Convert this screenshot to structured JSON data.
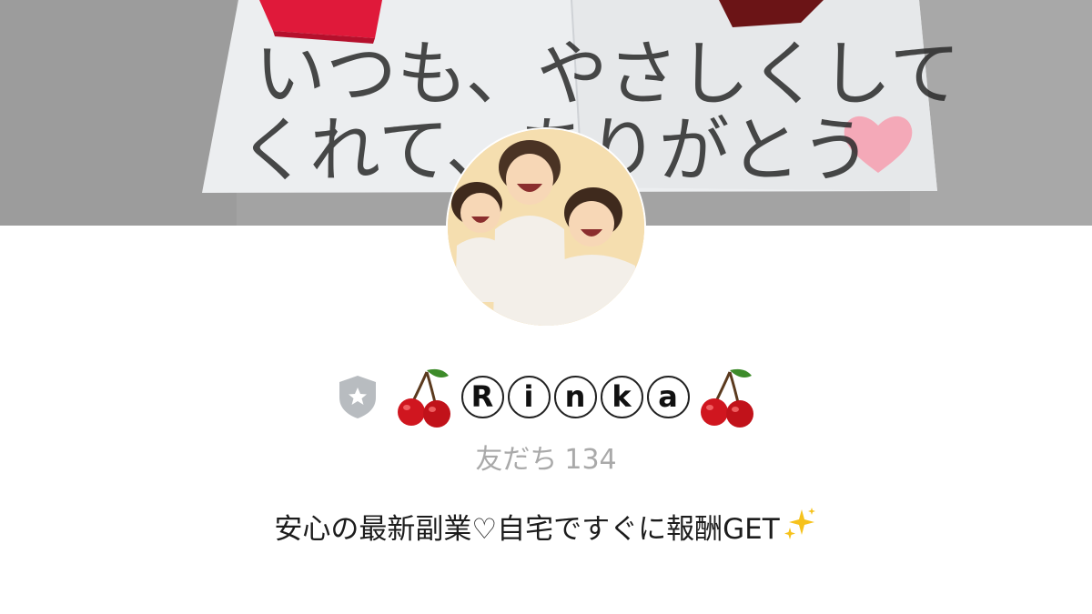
{
  "cover": {
    "letter_line1": "いつも、やさしくして",
    "letter_line2": "くれて、ありがとう"
  },
  "profile": {
    "name_prefix_emoji": "🍒",
    "name_letters": [
      "R",
      "i",
      "n",
      "k",
      "a"
    ],
    "name_suffix_emoji": "🍒",
    "friends_label": "友だち",
    "friends_count": "134",
    "bio": "安心の最新副業♡自宅ですぐに報酬GET",
    "bio_emoji": "✨"
  },
  "colors": {
    "cover_bg": "#a5a5a5",
    "paper": "#eef0f2",
    "badge": "#b8bcc0",
    "cherry_red": "#d0161f",
    "cherry_leaf": "#3d8b2a",
    "secondary_text": "#a9a9a9",
    "primary_text": "#1c1c1c"
  },
  "icons": {
    "badge": "shield-star-icon",
    "cherry": "cherry-icon",
    "sparkle": "sparkle-icon",
    "heart": "heart-icon"
  }
}
